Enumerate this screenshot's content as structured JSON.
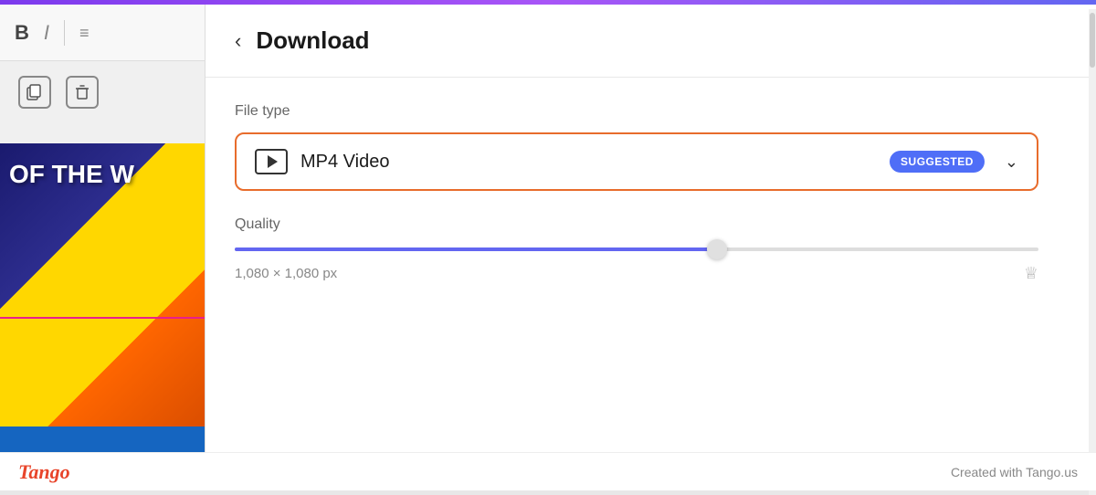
{
  "topBar": {
    "colors": [
      "#7c3aed",
      "#a855f7",
      "#6366f1"
    ]
  },
  "toolbar": {
    "boldLabel": "B",
    "italicLabel": "I",
    "listLabel": "≡"
  },
  "toolIcons": {
    "copy": "⧉",
    "delete": "🗑"
  },
  "downloadPanel": {
    "backArrow": "‹",
    "title": "Download",
    "fileTypeLabel": "File type",
    "fileTypeName": "MP4 Video",
    "suggestedBadge": "SUGGESTED",
    "qualityLabel": "Quality",
    "resolutionText": "1,080 × 1,080 px",
    "sliderFillPercent": 60,
    "chevronDown": "∨"
  },
  "footer": {
    "logoText": "Tango",
    "creditText": "Created with Tango.us"
  }
}
